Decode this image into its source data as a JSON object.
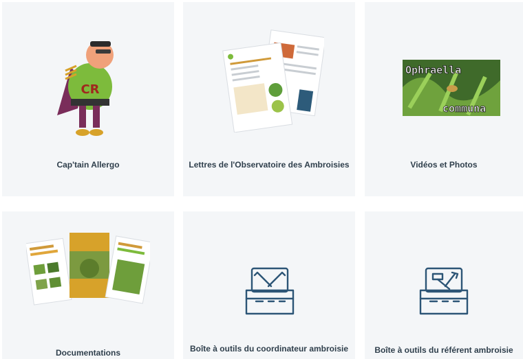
{
  "cards": [
    {
      "label": "Cap'tain Allergo",
      "icon": "captain-allergo-mascot"
    },
    {
      "label": "Lettres de l'Observatoire des Ambroisies",
      "icon": "newsletter-pages"
    },
    {
      "label": "Vidéos et Photos",
      "icon": "video-thumbnail",
      "video_title_1": "Ophraella",
      "video_title_2": "communa"
    },
    {
      "label": "Documentations",
      "icon": "brochures"
    },
    {
      "label": "Boîte à outils du coordinateur ambroisie",
      "icon": "toolbox-wrench-icon"
    },
    {
      "label": "Boîte à outils du référent ambroisie",
      "icon": "toolbox-hammer-icon"
    }
  ],
  "colors": {
    "card_bg": "#f4f6f8",
    "label": "#2f3f4c",
    "toolbox_stroke": "#2c5576"
  }
}
